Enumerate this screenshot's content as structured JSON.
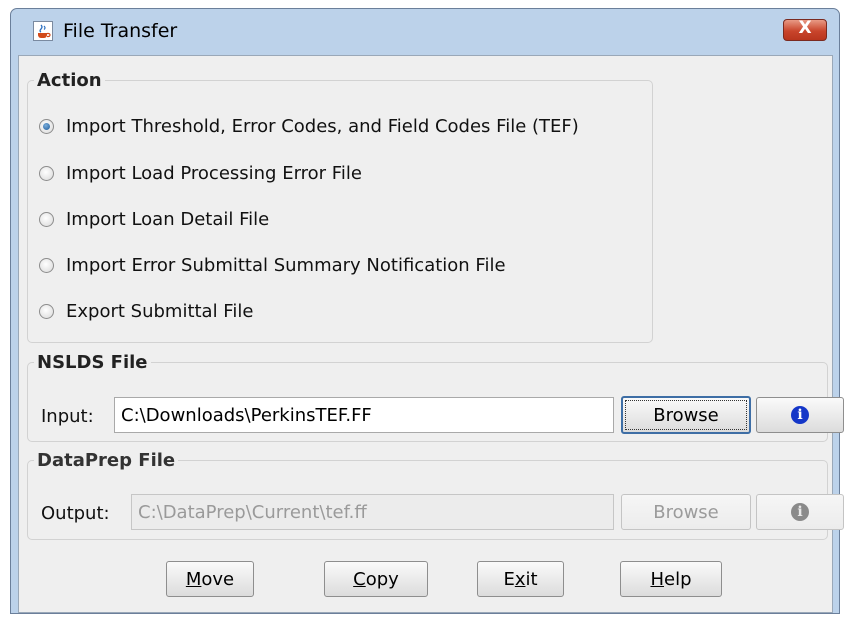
{
  "window": {
    "title": "File Transfer",
    "close_symbol": "X",
    "app_icon": "java-cup-icon"
  },
  "action": {
    "legend": "Action",
    "selected_index": 0,
    "options": [
      {
        "label": "Import Threshold, Error Codes, and Field Codes File (TEF)",
        "checked": true
      },
      {
        "label": "Import Load Processing Error File",
        "checked": false
      },
      {
        "label": "Import Loan Detail File",
        "checked": false
      },
      {
        "label": "Import Error Submittal Summary Notification File",
        "checked": false
      },
      {
        "label": "Export Submittal File",
        "checked": false
      }
    ]
  },
  "nslds": {
    "legend": "NSLDS File",
    "input_label": "Input:",
    "input_value": "C:\\Downloads\\PerkinsTEF.FF",
    "browse_label": "Browse",
    "info_glyph": "i"
  },
  "dataprep": {
    "legend": "DataPrep File",
    "output_label": "Output:",
    "output_value": "C:\\DataPrep\\Current\\tef.ff",
    "browse_label": "Browse",
    "info_glyph": "i",
    "enabled": false
  },
  "buttons": {
    "move": {
      "first": "M",
      "rest": "ove"
    },
    "copy": {
      "first": "C",
      "rest": "opy"
    },
    "exit": {
      "pre": "E",
      "mnemonic": "x",
      "post": "it"
    },
    "help": {
      "first": "H",
      "rest": "elp"
    }
  },
  "colors": {
    "title_bar": "#bcd2ea",
    "close_button": "#c9452c",
    "info_icon": "#1436c8",
    "focus_border": "#3e6ea5"
  }
}
